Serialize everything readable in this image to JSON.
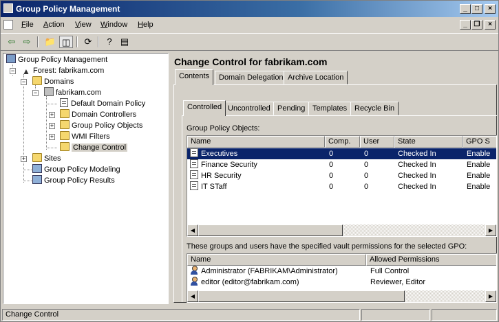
{
  "window": {
    "title": "Group Policy Management",
    "min": "_",
    "max": "□",
    "close": "×"
  },
  "menu": [
    "File",
    "Action",
    "View",
    "Window",
    "Help"
  ],
  "menu_accel": [
    "F",
    "A",
    "V",
    "W",
    "H"
  ],
  "tree": [
    {
      "label": "Group Policy Management",
      "icon": "gpmc-icon"
    },
    {
      "label": "Forest: fabrikam.com",
      "icon": "forest-icon"
    },
    {
      "label": "Domains",
      "icon": "domains-icon"
    },
    {
      "label": "fabrikam.com",
      "icon": "domain-icon"
    },
    {
      "label": "Default Domain Policy",
      "icon": "gpo-link-icon"
    },
    {
      "label": "Domain Controllers",
      "icon": "folder-icon"
    },
    {
      "label": "Group Policy Objects",
      "icon": "folder-icon"
    },
    {
      "label": "WMI Filters",
      "icon": "folder-icon"
    },
    {
      "label": "Change Control",
      "icon": "folder-icon"
    },
    {
      "label": "Sites",
      "icon": "sites-icon"
    },
    {
      "label": "Group Policy Modeling",
      "icon": "modeling-icon"
    },
    {
      "label": "Group Policy Results",
      "icon": "results-icon"
    }
  ],
  "main": {
    "heading": "Change Control for fabrikam.com",
    "outer_tabs": [
      "Contents",
      "Domain Delegation",
      "Archive Location"
    ],
    "inner_tabs": [
      "Controlled",
      "Uncontrolled",
      "Pending",
      "Templates",
      "Recycle Bin"
    ],
    "gpo_label": "Group Policy Objects:",
    "gpo_columns": [
      "Name",
      "Comp.",
      "User",
      "State",
      "GPO S"
    ],
    "gpo_rows": [
      [
        "Executives",
        "0",
        "0",
        "Checked In",
        "Enable"
      ],
      [
        "Finance Security",
        "0",
        "0",
        "Checked In",
        "Enable"
      ],
      [
        "HR Security",
        "0",
        "0",
        "Checked In",
        "Enable"
      ],
      [
        "IT STaff",
        "0",
        "0",
        "Checked In",
        "Enable"
      ]
    ],
    "perm_label": "These groups and users have the specified vault permissions for the selected GPO:",
    "perm_columns": [
      "Name",
      "Allowed Permissions"
    ],
    "perm_rows": [
      [
        "Administrator (FABRIKAM\\Administrator)",
        "Full Control"
      ],
      [
        "editor (editor@fabrikam.com)",
        "Reviewer, Editor"
      ]
    ]
  },
  "status": {
    "text": "Change Control"
  }
}
